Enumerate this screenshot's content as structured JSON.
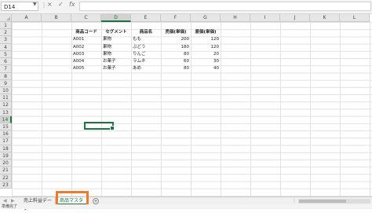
{
  "formula_bar": {
    "name_box": "D14",
    "cancel_icon": "×",
    "enter_icon": "✓",
    "fx_label": "fx",
    "value": ""
  },
  "columns": [
    "A",
    "B",
    "C",
    "D",
    "E",
    "F",
    "G",
    "H",
    "I",
    "J",
    "K",
    "L"
  ],
  "rows": [
    "1",
    "2",
    "3",
    "4",
    "5",
    "6",
    "7",
    "8",
    "9",
    "10",
    "11",
    "12",
    "13",
    "14",
    "15",
    "16",
    "17",
    "18",
    "19",
    "20",
    "21",
    "22",
    "23"
  ],
  "active_cell": "D14",
  "table": {
    "headers": [
      "商品コード",
      "セグメント",
      "商品名",
      "売価(単価)",
      "原価(単価)"
    ],
    "rows": [
      [
        "A001",
        "果物",
        "もも",
        "200",
        "120"
      ],
      [
        "A002",
        "果物",
        "ぶどう",
        "180",
        "120"
      ],
      [
        "A003",
        "果物",
        "りんご",
        "80",
        "20"
      ],
      [
        "A004",
        "お菓子",
        "ラムネ",
        "60",
        "30"
      ],
      [
        "A005",
        "お菓子",
        "あめ",
        "80",
        "40"
      ]
    ]
  },
  "sheet_tabs": [
    {
      "label": "売上料益データ",
      "active": false
    },
    {
      "label": "商品マスタ",
      "active": true
    }
  ],
  "add_sheet_label": "+",
  "status_text": "準備完了",
  "colors": {
    "accent": "#217346",
    "highlight": "#ee7a2a"
  }
}
